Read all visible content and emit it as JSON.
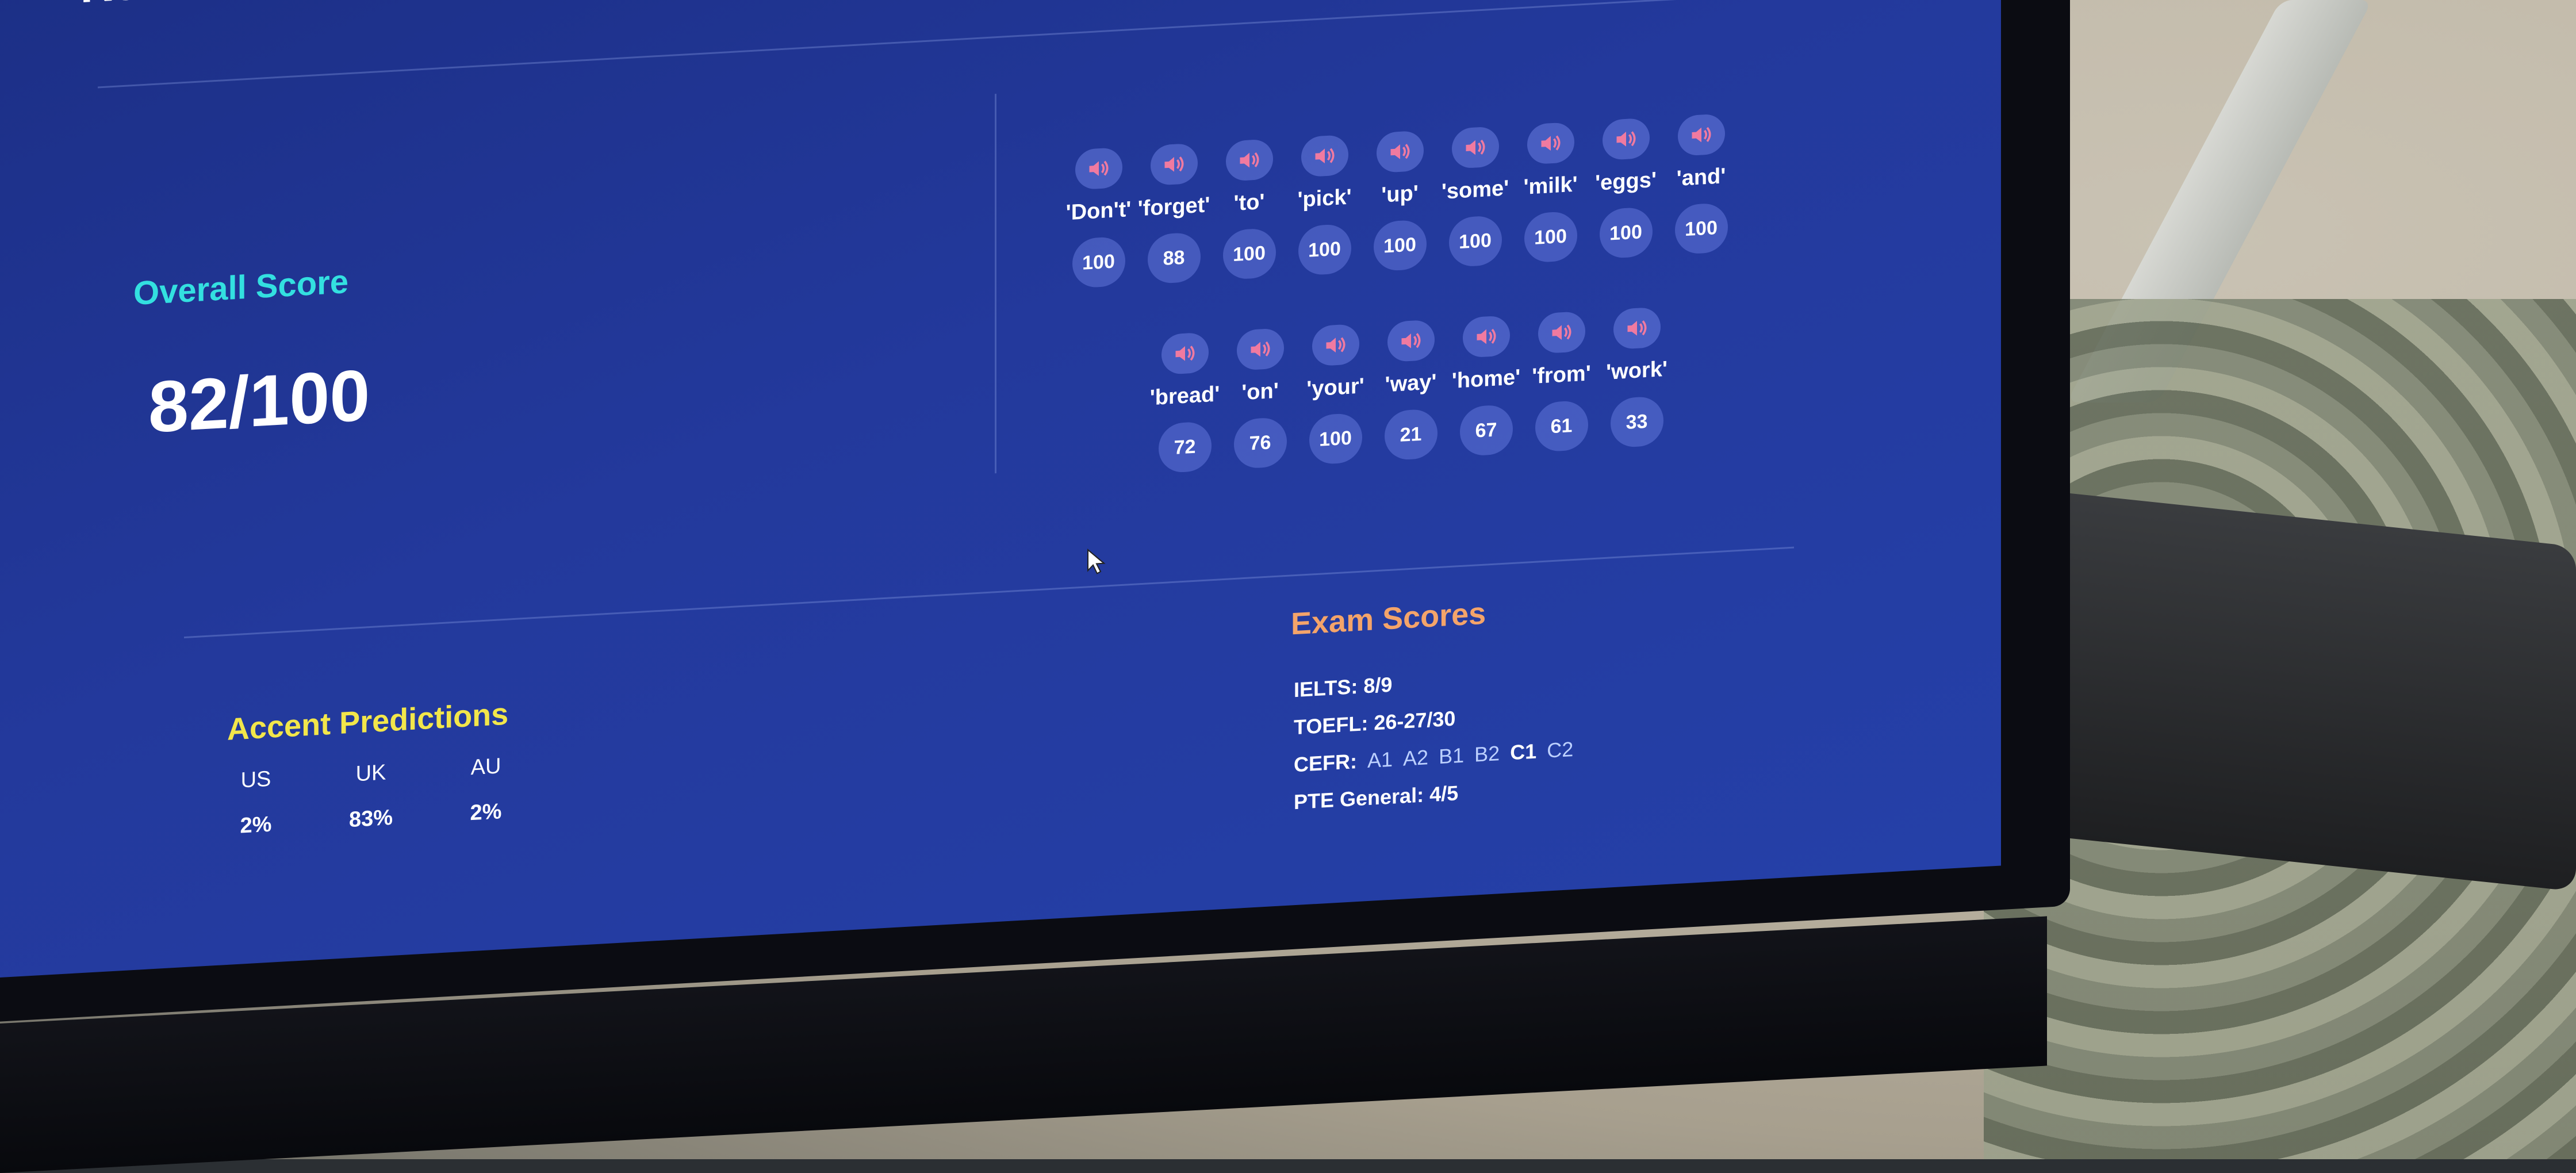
{
  "page": {
    "title": "Results"
  },
  "overall": {
    "label": "Overall Score",
    "score": "82/100"
  },
  "words_row1": [
    {
      "word": "'Don't'",
      "score": "100"
    },
    {
      "word": "'forget'",
      "score": "88"
    },
    {
      "word": "'to'",
      "score": "100"
    },
    {
      "word": "'pick'",
      "score": "100"
    },
    {
      "word": "'up'",
      "score": "100"
    },
    {
      "word": "'some'",
      "score": "100"
    },
    {
      "word": "'milk'",
      "score": "100"
    },
    {
      "word": "'eggs'",
      "score": "100"
    },
    {
      "word": "'and'",
      "score": "100"
    }
  ],
  "words_row2": [
    {
      "word": "'bread'",
      "score": "72"
    },
    {
      "word": "'on'",
      "score": "76"
    },
    {
      "word": "'your'",
      "score": "100"
    },
    {
      "word": "'way'",
      "score": "21"
    },
    {
      "word": "'home'",
      "score": "67"
    },
    {
      "word": "'from'",
      "score": "61"
    },
    {
      "word": "'work'",
      "score": "33"
    }
  ],
  "accent": {
    "title": "Accent Predictions",
    "columns": [
      {
        "label": "US",
        "value": "2%"
      },
      {
        "label": "UK",
        "value": "83%"
      },
      {
        "label": "AU",
        "value": "2%"
      }
    ]
  },
  "exam": {
    "title": "Exam Scores",
    "ielts": "IELTS: 8/9",
    "toefl": "TOEFL: 26-27/30",
    "cefr_label": "CEFR:",
    "cefr_levels": [
      "A1",
      "A2",
      "B1",
      "B2",
      "C1",
      "C2"
    ],
    "cefr_active": "C1",
    "pte": "PTE General: 4/5"
  },
  "colors": {
    "accent_cyan": "#33e0e0",
    "accent_yellow": "#f2e64a",
    "accent_orange": "#f4a46a",
    "speaker_pink": "#f07aa0"
  },
  "icons": {
    "play_word": "speaker-icon",
    "pointer": "cursor-icon"
  }
}
